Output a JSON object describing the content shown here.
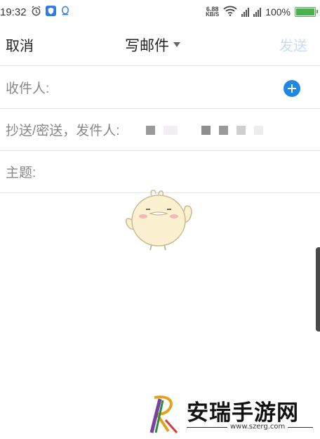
{
  "status_bar": {
    "time": "19:32",
    "net_speed_value": "6.88",
    "net_speed_unit": "KB/S",
    "battery": "100%",
    "battery_level": 1.0,
    "icons": [
      "alarm-icon",
      "shield-app-icon",
      "qq-icon",
      "wifi-icon",
      "signal-icon",
      "signal-icon",
      "battery-icon"
    ]
  },
  "header": {
    "cancel_label": "取消",
    "title": "写邮件",
    "send_label": "发送"
  },
  "fields": {
    "to_label": "收件人:",
    "cc_label": "抄送/密送，发件人:",
    "subject_label": "主题:"
  },
  "watermark": {
    "text": "安瑞手游网",
    "url": "www.szerg.com"
  },
  "colors": {
    "accent": "#1e88e5",
    "send_disabled": "#c6dcf2",
    "battery": "#4caf50"
  }
}
